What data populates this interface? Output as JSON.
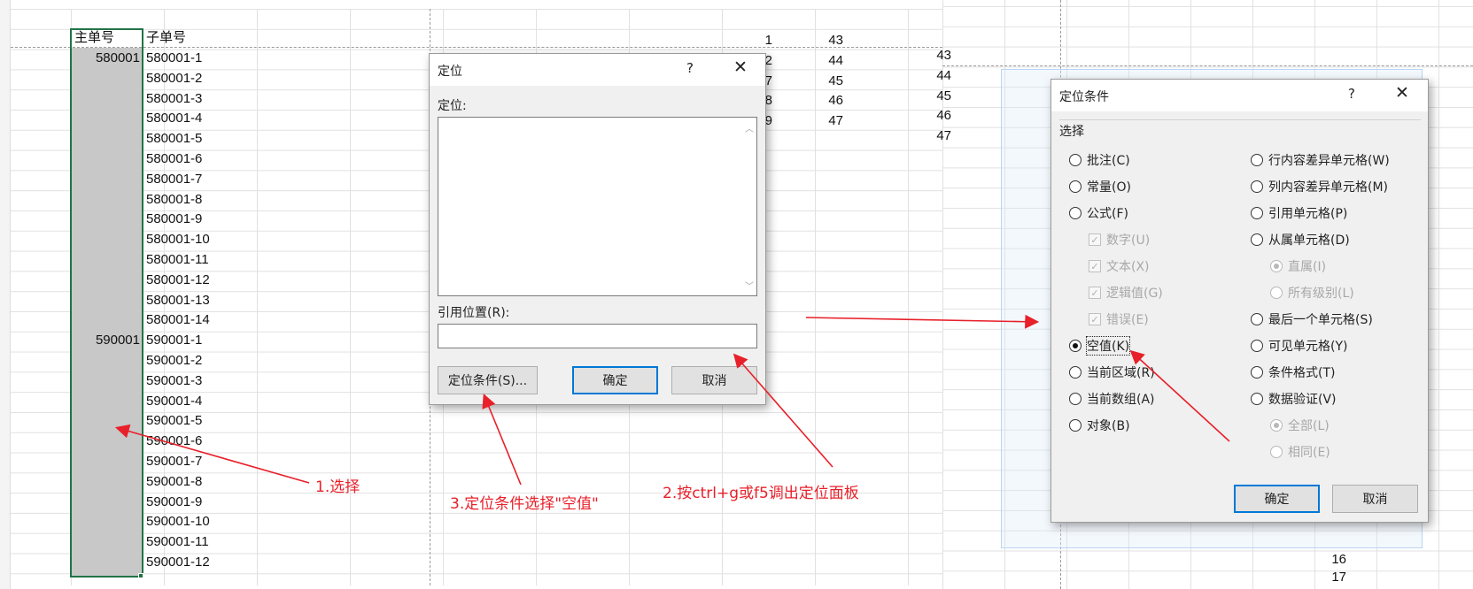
{
  "sheet_left": {
    "header_main": "主单号",
    "header_sub": "子单号",
    "main_values": [
      {
        "row": 1,
        "text": "580001"
      },
      {
        "row": 15,
        "text": "590001"
      }
    ],
    "sub_orders": [
      "580001-1",
      "580001-2",
      "580001-3",
      "580001-4",
      "580001-5",
      "580001-6",
      "580001-7",
      "580001-8",
      "580001-9",
      "580001-10",
      "580001-11",
      "580001-12",
      "580001-13",
      "580001-14",
      "590001-1",
      "590001-2",
      "590001-3",
      "590001-4",
      "590001-5",
      "590001-6",
      "590001-7",
      "590001-8",
      "590001-9",
      "590001-10",
      "590001-11",
      "590001-12"
    ],
    "col_a_numbers": [
      "1",
      "2",
      "7",
      "8",
      "9"
    ],
    "col_b_numbers": [
      "43",
      "44",
      "45",
      "46",
      "47"
    ]
  },
  "sheet_right": {
    "partial_numbers": [
      "43",
      "44",
      "45",
      "46",
      "47"
    ],
    "bottom_numbers": [
      "16",
      "17"
    ]
  },
  "goto_dialog": {
    "title": "定位",
    "help": "?",
    "close": "✕",
    "list_label": "定位:",
    "ref_label": "引用位置(R):",
    "ref_value": "",
    "special_button": "定位条件(S)...",
    "ok_button": "确定",
    "cancel_button": "取消"
  },
  "special_dialog": {
    "title": "定位条件",
    "help": "?",
    "close": "✕",
    "group_label": "选择",
    "left_options": [
      {
        "label": "批注(C)",
        "kind": "radio",
        "checked": false,
        "disabled": false
      },
      {
        "label": "常量(O)",
        "kind": "radio",
        "checked": false,
        "disabled": false
      },
      {
        "label": "公式(F)",
        "kind": "radio",
        "checked": false,
        "disabled": false
      },
      {
        "label": "数字(U)",
        "kind": "check",
        "checked": true,
        "disabled": true
      },
      {
        "label": "文本(X)",
        "kind": "check",
        "checked": true,
        "disabled": true
      },
      {
        "label": "逻辑值(G)",
        "kind": "check",
        "checked": true,
        "disabled": true
      },
      {
        "label": "错误(E)",
        "kind": "check",
        "checked": true,
        "disabled": true
      },
      {
        "label": "空值(K)",
        "kind": "radio",
        "checked": true,
        "disabled": false
      },
      {
        "label": "当前区域(R)",
        "kind": "radio",
        "checked": false,
        "disabled": false
      },
      {
        "label": "当前数组(A)",
        "kind": "radio",
        "checked": false,
        "disabled": false
      },
      {
        "label": "对象(B)",
        "kind": "radio",
        "checked": false,
        "disabled": false
      }
    ],
    "right_options": [
      {
        "label": "行内容差异单元格(W)",
        "kind": "radio",
        "checked": false,
        "disabled": false
      },
      {
        "label": "列内容差异单元格(M)",
        "kind": "radio",
        "checked": false,
        "disabled": false
      },
      {
        "label": "引用单元格(P)",
        "kind": "radio",
        "checked": false,
        "disabled": false
      },
      {
        "label": "从属单元格(D)",
        "kind": "radio",
        "checked": false,
        "disabled": false
      },
      {
        "label": "直属(I)",
        "kind": "radio",
        "checked": true,
        "disabled": true
      },
      {
        "label": "所有级别(L)",
        "kind": "radio",
        "checked": false,
        "disabled": true
      },
      {
        "label": "最后一个单元格(S)",
        "kind": "radio",
        "checked": false,
        "disabled": false
      },
      {
        "label": "可见单元格(Y)",
        "kind": "radio",
        "checked": false,
        "disabled": false
      },
      {
        "label": "条件格式(T)",
        "kind": "radio",
        "checked": false,
        "disabled": false
      },
      {
        "label": "数据验证(V)",
        "kind": "radio",
        "checked": false,
        "disabled": false
      },
      {
        "label": "全部(L)",
        "kind": "radio",
        "checked": true,
        "disabled": true
      },
      {
        "label": "相同(E)",
        "kind": "radio",
        "checked": false,
        "disabled": true
      }
    ],
    "ok_button": "确定",
    "cancel_button": "取消"
  },
  "annotations": {
    "step1": "1.选择",
    "step2": "2.按ctrl+g或f5调出定位面板",
    "step3": "3.定位条件选择\"空值\"",
    "color": "#e8202a"
  },
  "colors": {
    "selection_border": "#217346",
    "selection_fill": "#c8c8c8",
    "primary_button_border": "#0078d7"
  }
}
